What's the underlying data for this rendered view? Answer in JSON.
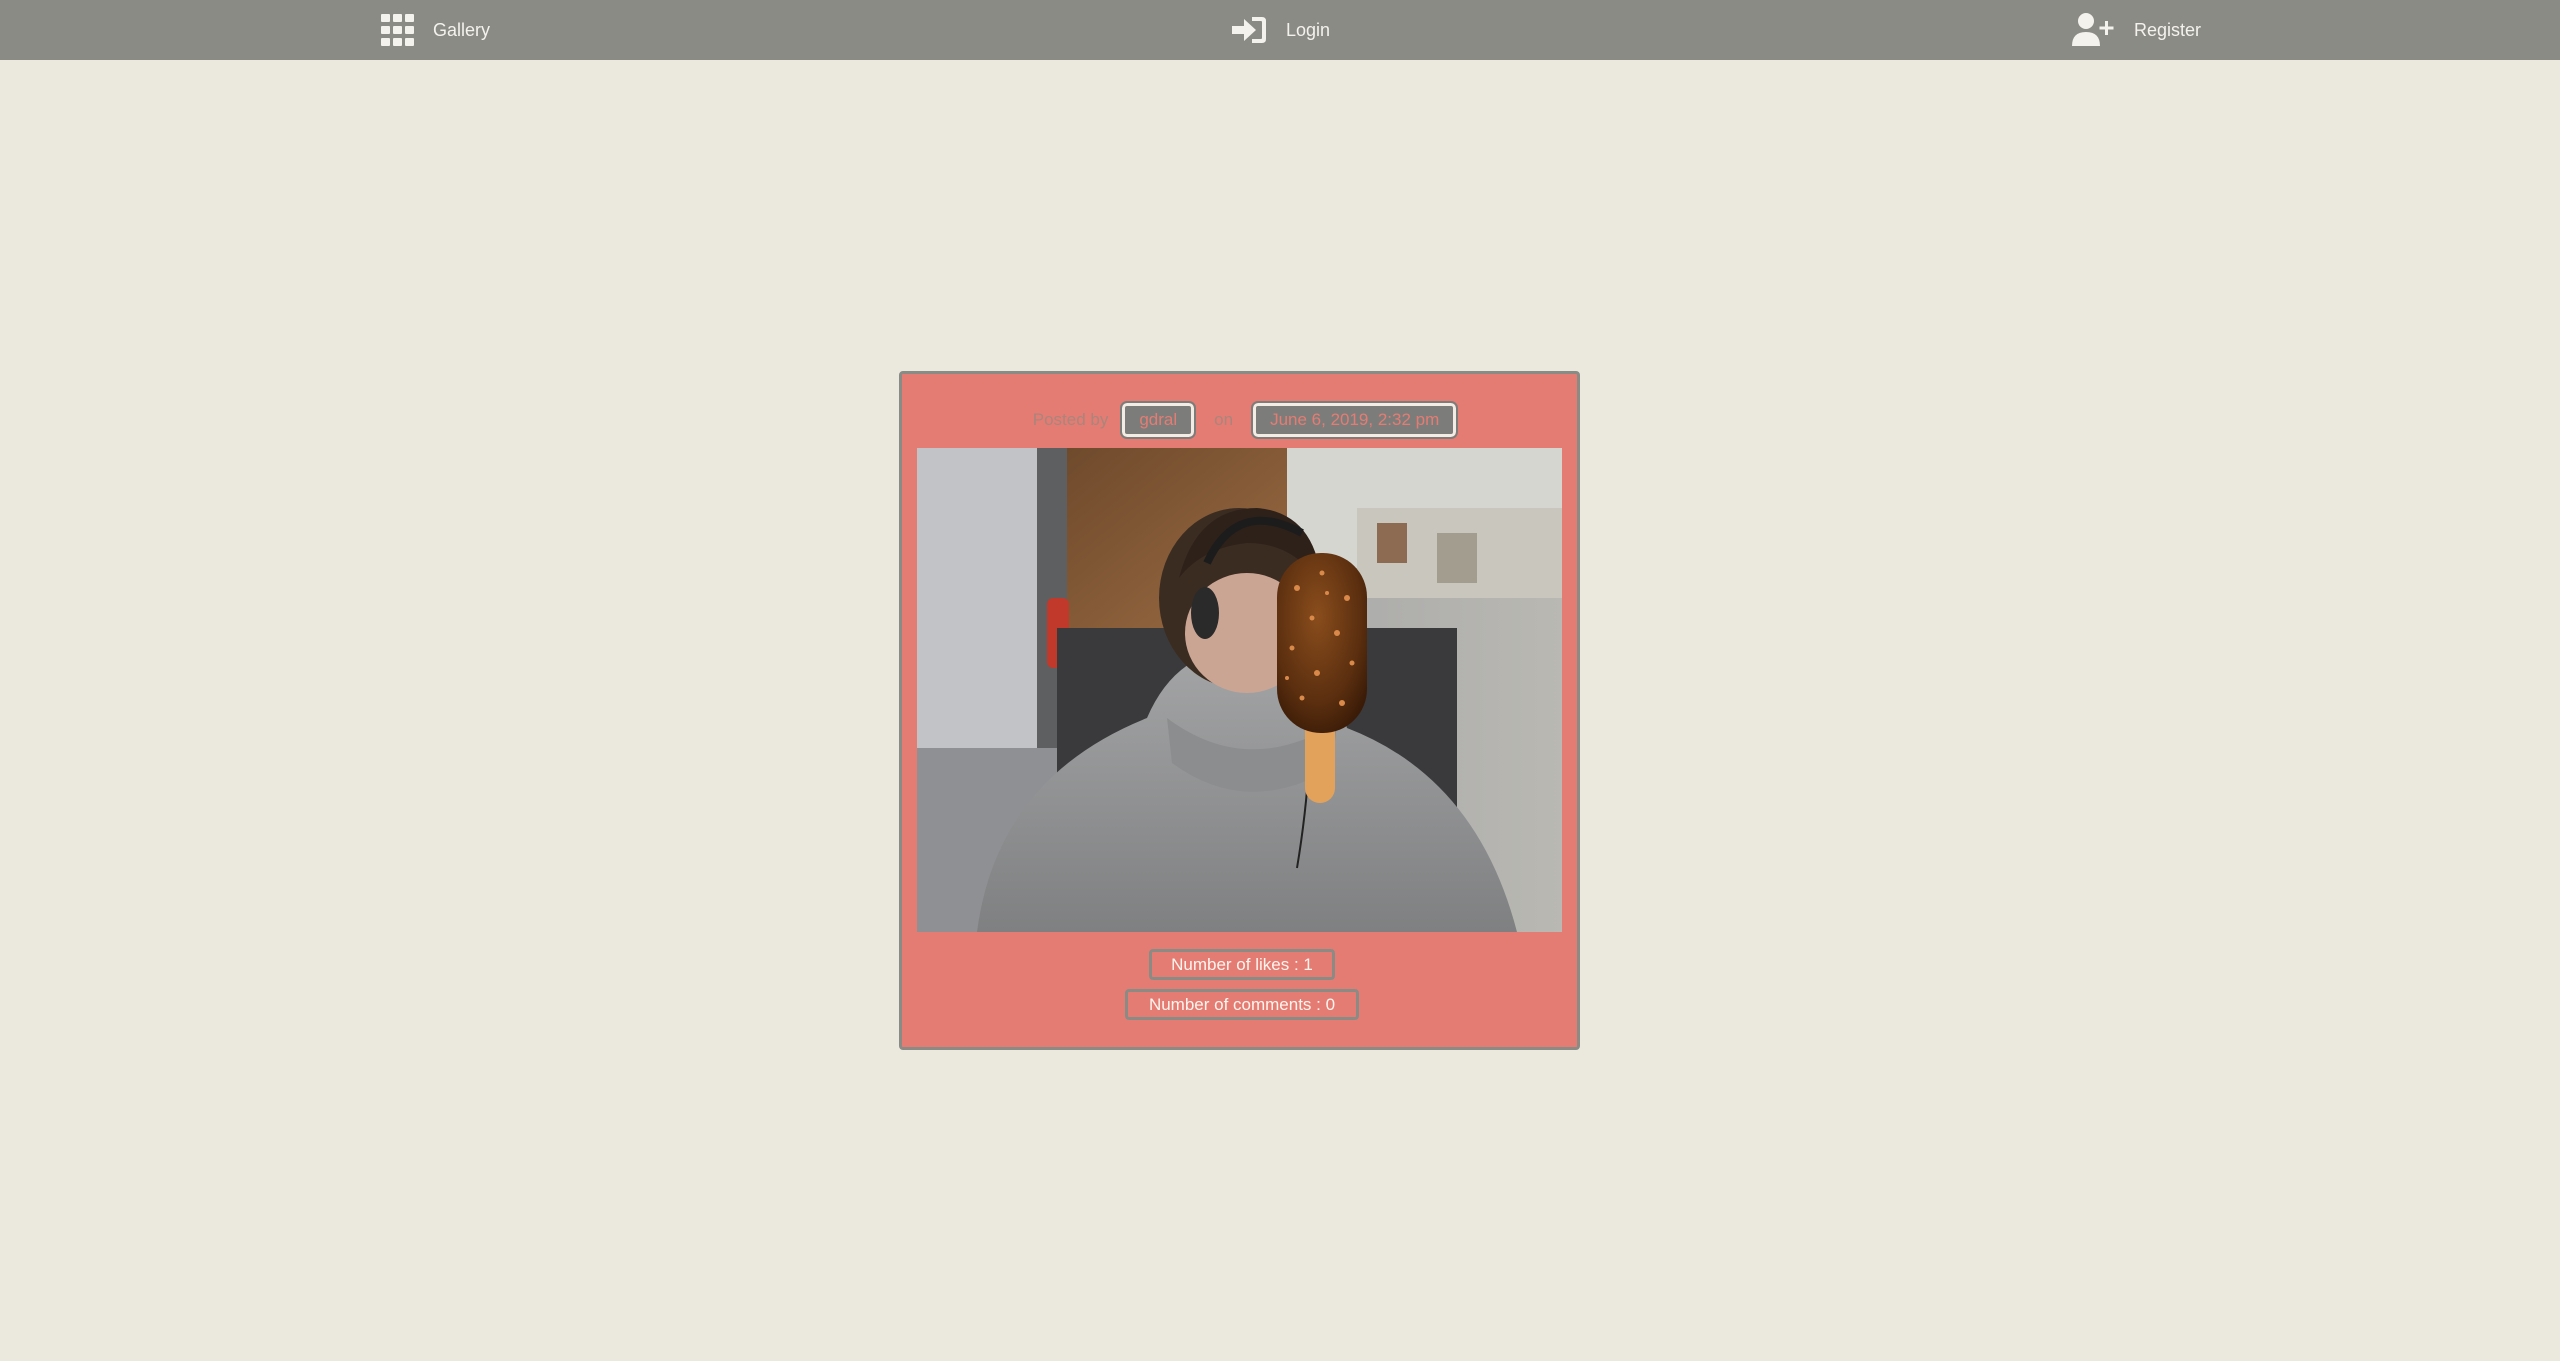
{
  "nav": {
    "gallery": {
      "label": "Gallery",
      "icon": "grid-icon"
    },
    "login": {
      "label": "Login",
      "icon": "sign-in-icon"
    },
    "register": {
      "label": "Register",
      "icon": "user-plus-icon"
    }
  },
  "post": {
    "posted_by_label": "Posted by",
    "author": "gdral",
    "on_label": "on",
    "date": "June 6, 2019, 2:32 pm",
    "likes_label": "Number of likes : 1",
    "comments_label": "Number of comments : 0"
  },
  "colors": {
    "navbar": "#8b8b86",
    "background": "#ebe8de",
    "card": "#e57c73",
    "chip": "#7c7d7a"
  }
}
